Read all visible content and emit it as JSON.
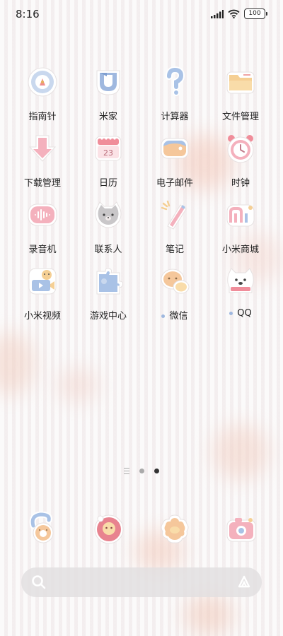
{
  "status_bar": {
    "time": "8:16",
    "battery_level": "100",
    "icons": [
      "signal-icon",
      "wifi-icon",
      "battery-icon"
    ]
  },
  "apps": [
    {
      "label": "指南针",
      "icon": "compass-icon",
      "dot": false
    },
    {
      "label": "米家",
      "icon": "mijia-icon",
      "dot": false
    },
    {
      "label": "计算器",
      "icon": "calculator-icon",
      "dot": false
    },
    {
      "label": "文件管理",
      "icon": "folder-icon",
      "dot": false
    },
    {
      "label": "下载管理",
      "icon": "download-icon",
      "dot": false
    },
    {
      "label": "日历",
      "icon": "calendar-icon",
      "dot": false,
      "calendar_day": "23"
    },
    {
      "label": "电子邮件",
      "icon": "email-icon",
      "dot": false
    },
    {
      "label": "时钟",
      "icon": "clock-icon",
      "dot": false
    },
    {
      "label": "录音机",
      "icon": "recorder-icon",
      "dot": false
    },
    {
      "label": "联系人",
      "icon": "contacts-icon",
      "dot": false
    },
    {
      "label": "笔记",
      "icon": "notes-icon",
      "dot": false
    },
    {
      "label": "小米商城",
      "icon": "mi-store-icon",
      "dot": false
    },
    {
      "label": "小米视频",
      "icon": "mi-video-icon",
      "dot": false
    },
    {
      "label": "游戏中心",
      "icon": "game-center-icon",
      "dot": false
    },
    {
      "label": "微信",
      "icon": "wechat-icon",
      "dot": true
    },
    {
      "label": "QQ",
      "icon": "qq-icon",
      "dot": true
    }
  ],
  "pager": {
    "pages": 2,
    "active_page": 2
  },
  "dock": [
    {
      "icon": "phone-icon"
    },
    {
      "icon": "messages-icon"
    },
    {
      "icon": "browser-icon"
    },
    {
      "icon": "camera-icon"
    }
  ],
  "search_bar": {
    "search_icon": "search-icon",
    "assistant_icon": "assistant-icon"
  },
  "colors": {
    "accent_dot": "#9fb8df",
    "active_page_dot": "#333333"
  }
}
